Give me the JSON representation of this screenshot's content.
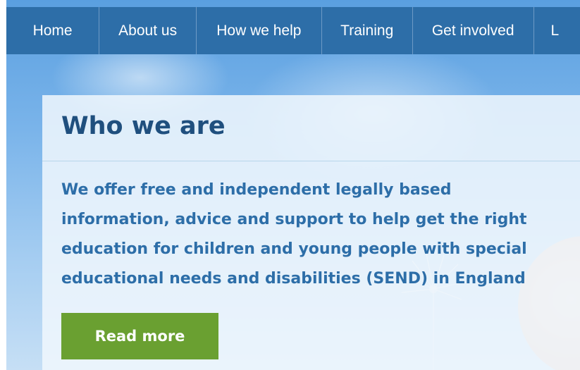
{
  "nav": {
    "items": [
      {
        "label": "Home"
      },
      {
        "label": "About us"
      },
      {
        "label": "How we help"
      },
      {
        "label": "Training"
      },
      {
        "label": "Get involved"
      },
      {
        "label": "L"
      }
    ]
  },
  "hero": {
    "title": "Who we are",
    "intro_lines": [
      "We offer free and independent legally based",
      "information, advice and support to help get the right",
      "education for children and young people with special",
      "educational needs and disabilities (SEND) in England"
    ],
    "cta_label": "Read more"
  },
  "colors": {
    "nav_background": "#2d6ea8",
    "title_text": "#1f4f7e",
    "body_text": "#2d6ea8",
    "cta_background": "#6aa031"
  }
}
